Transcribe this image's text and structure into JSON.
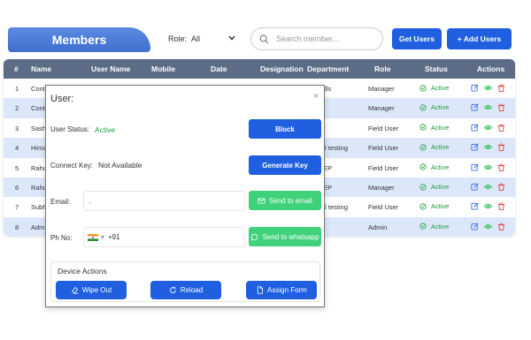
{
  "header": {
    "title": "Members",
    "role_label": "Role:",
    "role_value": "All",
    "search_placeholder": "Search member...",
    "get_users": "Get Users",
    "add_users": "+ Add Users"
  },
  "table": {
    "columns": [
      "#",
      "Name",
      "User Name",
      "Mobile",
      "Date",
      "Designation",
      "Department",
      "Role",
      "Status",
      "Actions"
    ],
    "rows": [
      {
        "num": "1",
        "name": "Cont",
        "dept": "ells",
        "role": "Manager",
        "status": "Active"
      },
      {
        "num": "2",
        "name": "Cont",
        "dept": "T",
        "role": "Manager",
        "status": "Active"
      },
      {
        "num": "3",
        "name": "Sash",
        "dept": "T",
        "role": "Field User",
        "status": "Active"
      },
      {
        "num": "4",
        "name": "Hima",
        "dept": "al testing",
        "role": "Field User",
        "status": "Active"
      },
      {
        "num": "5",
        "name": "Rahu",
        "dept": "IEP",
        "role": "Field User",
        "status": "Active"
      },
      {
        "num": "6",
        "name": "Rahu",
        "dept": "IEP",
        "role": "Manager",
        "status": "Active"
      },
      {
        "num": "7",
        "name": "Subh",
        "dept": "al testing",
        "role": "Field User",
        "status": "Active"
      },
      {
        "num": "8",
        "name": "Adm",
        "dept": "",
        "role": "Admin",
        "status": "Active"
      }
    ]
  },
  "modal": {
    "title": "User:",
    "close": "×",
    "user_status_label": "User Status:",
    "user_status_value": "Active",
    "block": "Block",
    "connect_key_label": "Connect Key:",
    "connect_key_value": "Not Available",
    "generate_key": "Generate Key",
    "email_label": "Email:",
    "email_value": ".",
    "send_email": "Send to email",
    "phone_label": "Ph No:",
    "phone_code": "+91",
    "send_whatsapp": "Send to whatsapp",
    "device_actions_title": "Device Actions",
    "wipe_out": "Wipe Out",
    "reload": "Reload",
    "assign_form": "Assign Form"
  },
  "colors": {
    "primary": "#1f5fe0",
    "header_bg": "#5c6c86",
    "row_alt": "#dce8fa",
    "active_green": "#1e9b3b",
    "send_green": "#3fd27a",
    "edit_icon": "#3a6fe0",
    "view_icon": "#2fbf5a",
    "delete_icon": "#e04545"
  }
}
